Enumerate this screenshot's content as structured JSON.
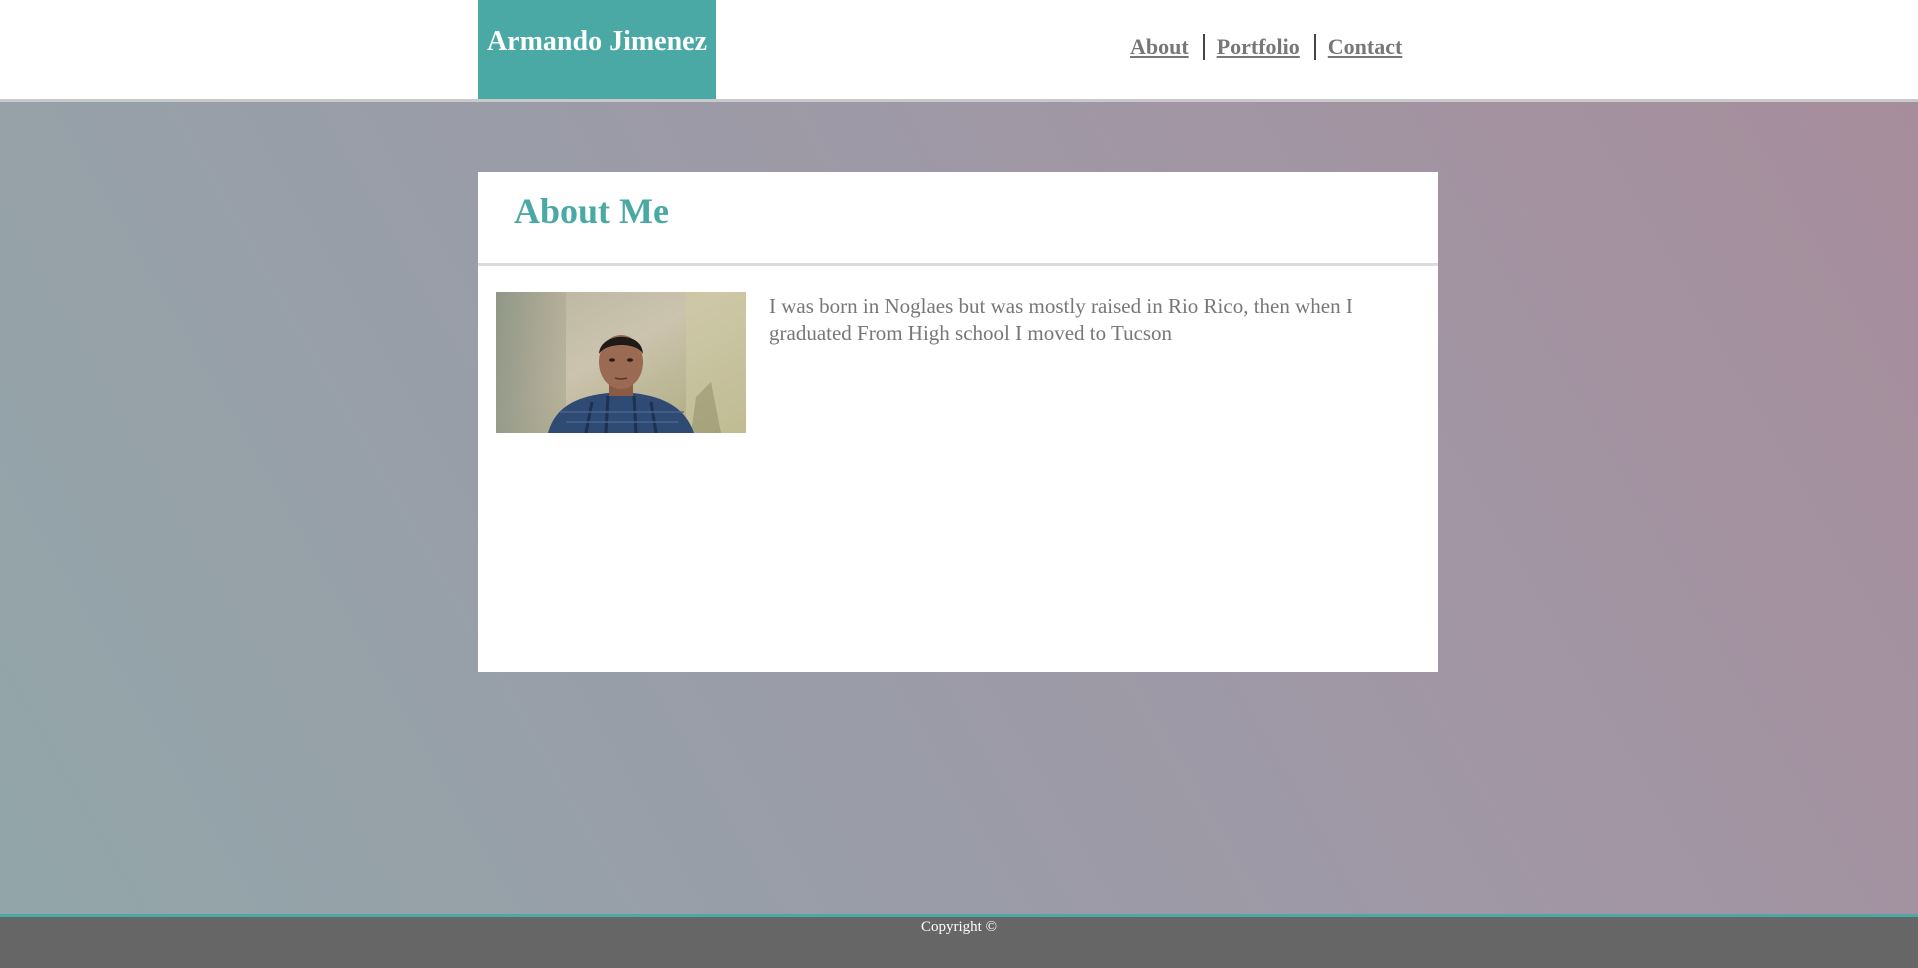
{
  "header": {
    "brand": "Armando Jimenez",
    "nav": {
      "about": "About",
      "portfolio": "Portfolio",
      "contact": "Contact"
    }
  },
  "about": {
    "title": "About Me",
    "bio": "I was born in Noglaes but was mostly raised in Rio Rico, then when I graduated From High school I moved to Tucson"
  },
  "footer": {
    "copyright": "Copyright ©"
  },
  "colors": {
    "accent": "#4aa9a5",
    "footer": "#666666",
    "nav_text": "#777777"
  }
}
